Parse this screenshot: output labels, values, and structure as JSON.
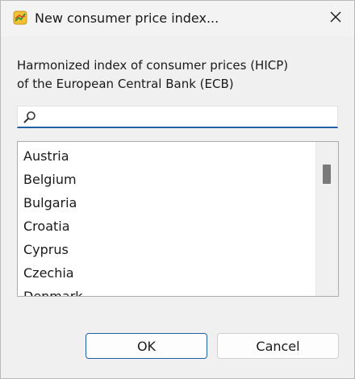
{
  "window": {
    "title": "New consumer price index...",
    "icon": "chart-app-icon",
    "close_icon": "close-icon"
  },
  "description": {
    "line1": "Harmonized index of consumer prices (HICP)",
    "line2": "of the European Central Bank (ECB)"
  },
  "search": {
    "icon": "search-icon",
    "value": "",
    "placeholder": ""
  },
  "countries": {
    "items": [
      "Austria",
      "Belgium",
      "Bulgaria",
      "Croatia",
      "Cyprus",
      "Czechia",
      "Denmark"
    ]
  },
  "buttons": {
    "ok_label": "OK",
    "cancel_label": "Cancel"
  },
  "colors": {
    "accent": "#1f5fa6",
    "background": "#f0f0f0",
    "scroll_thumb": "#7a7a7a"
  }
}
